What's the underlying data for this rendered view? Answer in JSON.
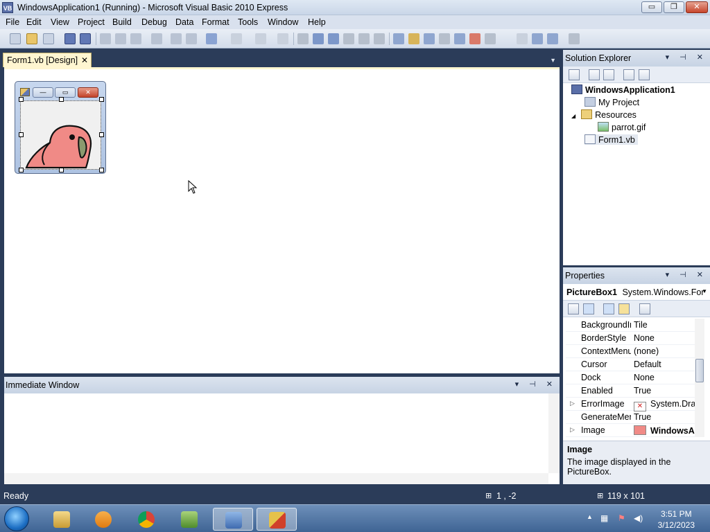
{
  "window": {
    "title": "WindowsApplication1 (Running) - Microsoft Visual Basic 2010 Express",
    "icon_label": "VB",
    "minimize_glyph": "▭",
    "restore_glyph": "❐",
    "close_glyph": "✕"
  },
  "menu": [
    "File",
    "Edit",
    "View",
    "Project",
    "Build",
    "Debug",
    "Data",
    "Format",
    "Tools",
    "Window",
    "Help"
  ],
  "document": {
    "tab_label": "Form1.vb [Design]",
    "tab_close_glyph": "✕",
    "dropdown_glyph": "▼"
  },
  "solution_explorer": {
    "title": "Solution Explorer",
    "header_buttons": "▾ ⊣ ✕",
    "solution": "WindowsApplication1",
    "items": [
      "My Project",
      "Resources",
      "parrot.gif",
      "Form1.vb"
    ],
    "expander": "◢"
  },
  "properties": {
    "title": "Properties",
    "header_buttons": "▾ ⊣ ✕",
    "object_name": "PictureBox1",
    "object_type": "System.Windows.For",
    "rows": [
      {
        "name": "BackgroundIr",
        "value": "Tile"
      },
      {
        "name": "BorderStyle",
        "value": "None"
      },
      {
        "name": "ContextMenu",
        "value": "(none)"
      },
      {
        "name": "Cursor",
        "value": "Default"
      },
      {
        "name": "Dock",
        "value": "None"
      },
      {
        "name": "Enabled",
        "value": "True"
      },
      {
        "name": "ErrorImage",
        "value": "System.Dra"
      },
      {
        "name": "GenerateMen",
        "value": "True"
      },
      {
        "name": "Image",
        "value": "WindowsA"
      }
    ],
    "description_title": "Image",
    "description_text": "The image displayed in the PictureBox."
  },
  "immediate_window": {
    "title": "Immediate Window",
    "header_buttons": "▾ ⊣ ✕"
  },
  "status": {
    "ready": "Ready",
    "position": "1 , -2",
    "size": "119 x 101"
  },
  "taskbar": {
    "apps": [
      "file-explorer",
      "media-player",
      "chrome",
      "visual-csharp",
      "visual-basic",
      "remote-app"
    ],
    "time": "3:51 PM",
    "date": "3/12/2023"
  },
  "colors": {
    "chrome_dark": "#2b3c59",
    "tab_active": "#fff6d1",
    "parrot": "#f08a86"
  }
}
